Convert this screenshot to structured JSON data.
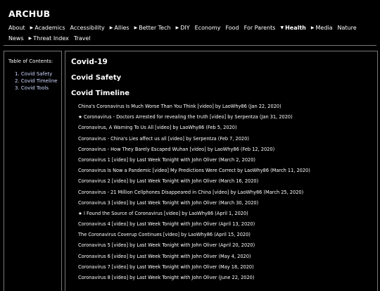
{
  "site": {
    "title": "ARCHUB",
    "nav_row1": [
      {
        "label": "About",
        "arrow": false,
        "bold": false
      },
      {
        "label": "Academics",
        "arrow": true,
        "bold": false
      },
      {
        "label": "Accessibility",
        "arrow": false,
        "bold": false
      },
      {
        "label": "Allies",
        "arrow": true,
        "bold": false
      },
      {
        "label": "Better Tech",
        "arrow": true,
        "bold": false
      },
      {
        "label": "DIY",
        "arrow": true,
        "bold": false
      },
      {
        "label": "Economy",
        "arrow": false,
        "bold": false
      },
      {
        "label": "Food",
        "arrow": false,
        "bold": false
      },
      {
        "label": "For Parents",
        "arrow": false,
        "bold": false
      },
      {
        "label": "Health",
        "arrow": true,
        "expanded": true,
        "bold": true
      },
      {
        "label": "Media",
        "arrow": true,
        "bold": false
      },
      {
        "label": "Nature",
        "arrow": false,
        "bold": false
      }
    ],
    "nav_row2": [
      {
        "label": "News",
        "arrow": false,
        "bold": false
      },
      {
        "label": "Threat Index",
        "arrow": true,
        "bold": false
      },
      {
        "label": "Travel",
        "arrow": false,
        "bold": false
      }
    ]
  },
  "toc": {
    "title": "Table of Contents:",
    "items": [
      "1. Covid Safety",
      "2. Covid Timeline",
      "3. Covid Tools"
    ]
  },
  "main": {
    "title": "Covid-19",
    "section1": "Covid Safety",
    "section2": "Covid Timeline",
    "videos": [
      "China's Coronavirus Is Much Worse Than You Think [video] by LaoWhy86 (Jan 22, 2020)",
      "★ Coronavirus - Doctors Arrested for revealing the truth [video] by Serpentza (Jan 31, 2020)",
      "Coronavirus, A Warning To Us All [video] by LaoWhy86 (Feb 5, 2020)",
      "Coronavirus - China's Lies affect us all [video] by Serpentza (Feb 7, 2020)",
      "Coronavirus - How They Barely Escaped Wuhan [video] by LaoWhy86 (Feb 12, 2020)",
      "Coronavirus 1 [video] by Last Week Tonight with John Oliver (March 2, 2020)",
      "Coronavirus Is Now a Pandemic [video] My Predictions Were Correct by LaoWhy86 (March 11, 2020)",
      "Coronavirus 2 [video] by Last Week Tonight with John Oliver (March 16, 2020)",
      "Coronavirus - 21 Million Cellphones Disappeared in China [video] by LaoWhy86 (March 25, 2020)",
      "Coronavirus 3 [video] by Last Week Tonight with John Oliver (March 30, 2020)",
      "★ I Found the Source of Coronavirus [video] by LaoWhy86 (April 1, 2020)",
      "Coronavirus 4 [video] by Last Week Tonight with John Oliver (April 13, 2020)",
      "The Coronavirus Coverup Continues [video] by LaoWhy86 (April 15, 2020)",
      "Coronavirus 5 [video] by Last Week Tonight with John Oliver (April 20, 2020)",
      "Coronavirus 6 [video] by Last Week Tonight with John Oliver (May 4, 2020)",
      "Coronavirus 7 [video] by Last Week Tonight with John Oliver (May 18, 2020)",
      "Coronavirus 8 [video] by Last Week Tonight with John Oliver (June 22, 2020)"
    ]
  }
}
